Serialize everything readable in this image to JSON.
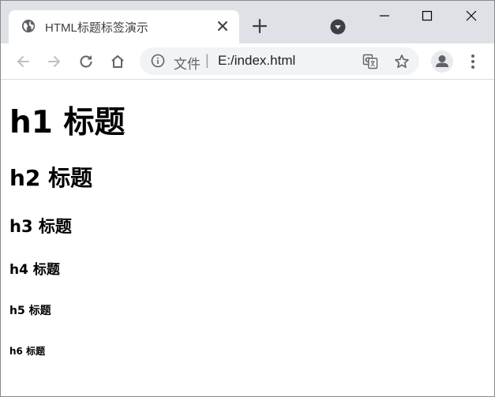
{
  "tab": {
    "title": "HTML标题标签演示"
  },
  "omnibox": {
    "scheme_label": "文件",
    "separator": "|",
    "url": "E:/index.html"
  },
  "page": {
    "h1": "h1 标题",
    "h2": "h2 标题",
    "h3": "h3 标题",
    "h4": "h4 标题",
    "h5": "h5 标题",
    "h6": "h6 标题"
  },
  "icons": {
    "favicon": "globe-icon",
    "tab_close": "close-icon",
    "new_tab": "plus-icon",
    "profile_dropdown": "chevron-down-circle-icon",
    "minimize": "minimize-icon",
    "maximize": "maximize-icon",
    "window_close": "close-icon",
    "back": "arrow-left-icon",
    "forward": "arrow-right-icon",
    "reload": "reload-icon",
    "home": "home-icon",
    "info": "info-icon",
    "translate": "translate-icon",
    "bookmark": "star-icon",
    "account": "account-icon",
    "menu": "kebab-menu-icon"
  },
  "colors": {
    "tabstrip_bg": "#dee1e6",
    "omnibox_bg": "#f1f3f4",
    "icon_color": "#5f6368",
    "text_color": "#000000"
  }
}
